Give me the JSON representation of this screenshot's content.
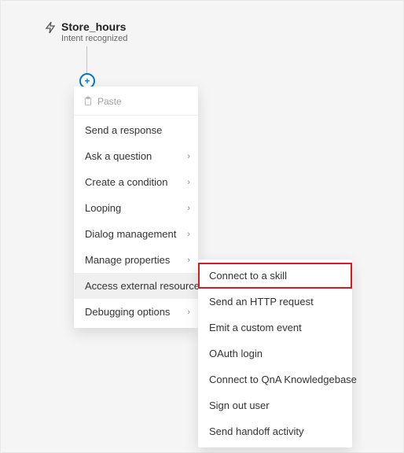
{
  "trigger": {
    "title": "Store_hours",
    "subtitle": "Intent recognized"
  },
  "primaryMenu": {
    "pasteLabel": "Paste",
    "items": [
      {
        "label": "Send a response",
        "submenu": false
      },
      {
        "label": "Ask a question",
        "submenu": true
      },
      {
        "label": "Create a condition",
        "submenu": true
      },
      {
        "label": "Looping",
        "submenu": true
      },
      {
        "label": "Dialog management",
        "submenu": true
      },
      {
        "label": "Manage properties",
        "submenu": true
      },
      {
        "label": "Access external resources",
        "submenu": true,
        "hovered": true
      },
      {
        "label": "Debugging options",
        "submenu": true
      }
    ]
  },
  "secondaryMenu": {
    "items": [
      {
        "label": "Connect to a skill",
        "highlighted": true
      },
      {
        "label": "Send an HTTP request"
      },
      {
        "label": "Emit a custom event"
      },
      {
        "label": "OAuth login"
      },
      {
        "label": "Connect to QnA Knowledgebase"
      },
      {
        "label": "Sign out user"
      },
      {
        "label": "Send handoff activity"
      }
    ]
  }
}
